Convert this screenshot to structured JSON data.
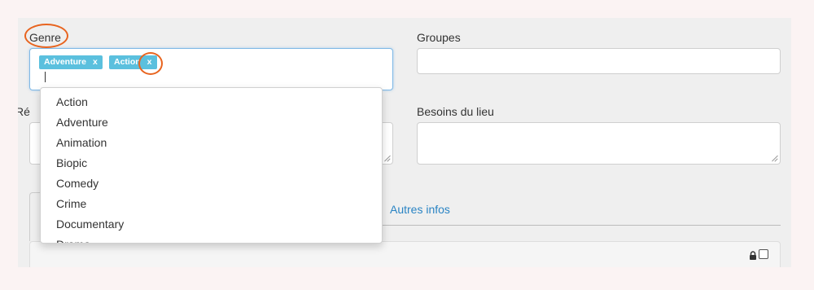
{
  "form": {
    "genre": {
      "label": "Genre",
      "tags": [
        {
          "label": "Adventure",
          "remove": "x"
        },
        {
          "label": "Action",
          "remove": "x"
        }
      ]
    },
    "groupes": {
      "label": "Groupes",
      "value": ""
    },
    "realisation": {
      "label_partial": "Ré"
    },
    "besoins": {
      "label": "Besoins du lieu",
      "value": ""
    }
  },
  "tabs": {
    "autres_infos": "Autres infos"
  },
  "dropdown": {
    "options": [
      "Action",
      "Adventure",
      "Animation",
      "Biopic",
      "Comedy",
      "Crime",
      "Documentary",
      "Drama"
    ]
  },
  "colors": {
    "tag": "#5bc0de",
    "highlight_ring": "#e8641f",
    "link": "#2a84c4"
  }
}
